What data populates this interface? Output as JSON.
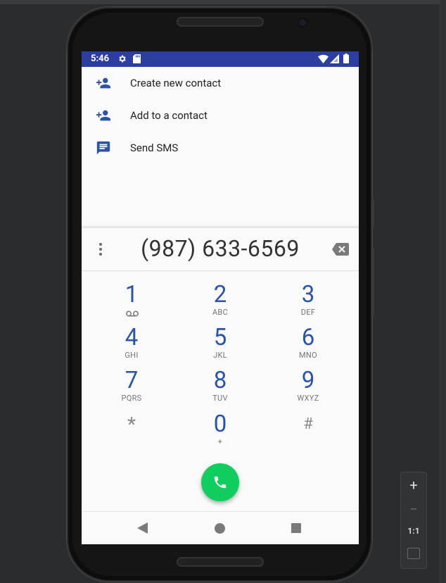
{
  "status_bar": {
    "time": "5:46",
    "colors": {
      "background": "#2c3e9f",
      "foreground": "#ffffff"
    }
  },
  "menu": {
    "items": [
      {
        "label": "Create new contact",
        "icon": "person-add-icon"
      },
      {
        "label": "Add to a contact",
        "icon": "person-add-icon"
      },
      {
        "label": "Send SMS",
        "icon": "message-icon"
      }
    ]
  },
  "dialer": {
    "number": "(987) 633-6569",
    "keys": [
      {
        "digit": "1",
        "letters": ""
      },
      {
        "digit": "2",
        "letters": "ABC"
      },
      {
        "digit": "3",
        "letters": "DEF"
      },
      {
        "digit": "4",
        "letters": "GHI"
      },
      {
        "digit": "5",
        "letters": "JKL"
      },
      {
        "digit": "6",
        "letters": "MNO"
      },
      {
        "digit": "7",
        "letters": "PQRS"
      },
      {
        "digit": "8",
        "letters": "TUV"
      },
      {
        "digit": "9",
        "letters": "WXYZ"
      },
      {
        "digit": "*",
        "letters": ""
      },
      {
        "digit": "0",
        "letters": "+"
      },
      {
        "digit": "#",
        "letters": ""
      }
    ],
    "accent_color": "#2c53a5",
    "call_button_color": "#0fce5d"
  },
  "zoom_panel": {
    "zoom_in": "+",
    "zoom_out": "−",
    "actual_size": "1:1"
  }
}
